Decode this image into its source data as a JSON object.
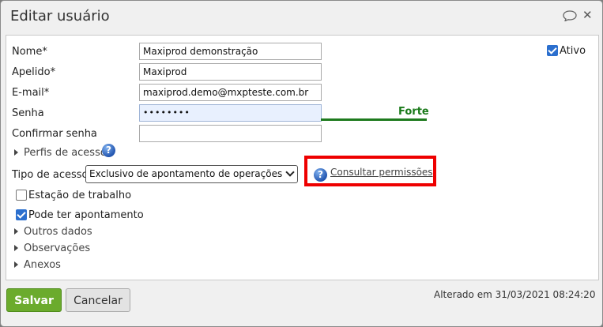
{
  "dialog": {
    "title": "Editar usuário"
  },
  "form": {
    "nome_label": "Nome*",
    "nome_value": "Maxiprod demonstração",
    "apelido_label": "Apelido*",
    "apelido_value": "Maxiprod",
    "email_label": "E-mail*",
    "email_value": "maxiprod.demo@mxpteste.com.br",
    "senha_label": "Senha",
    "senha_value": "••••••••",
    "senha_strength": "Forte",
    "confirmar_label": "Confirmar senha",
    "confirmar_value": "",
    "ativo_label": "Ativo",
    "ativo_checked": true,
    "perfis_label": "Perfis de acesso",
    "tipo_acesso_label": "Tipo de acesso",
    "tipo_acesso_value": "Exclusivo de apontamento de operações",
    "consultar_link": "Consultar permissões",
    "estacao_label": "Estação de trabalho",
    "estacao_checked": false,
    "pode_apontamento_label": "Pode ter apontamento",
    "pode_apontamento_checked": true,
    "outros_label": "Outros dados",
    "observacoes_label": "Observações",
    "anexos_label": "Anexos"
  },
  "footer": {
    "save_label": "Salvar",
    "cancel_label": "Cancelar",
    "altered_text": "Alterado em 31/03/2021 08:24:20"
  },
  "icons": {
    "chat": "speech-bubble-icon",
    "close": "close-icon",
    "help": "help-icon",
    "expand": "triangle-right-icon"
  },
  "colors": {
    "save_button": "#6bab2d",
    "strength": "#1a7a1a",
    "highlight_box": "#ee0000",
    "checkbox_checked": "#2b6fce"
  }
}
